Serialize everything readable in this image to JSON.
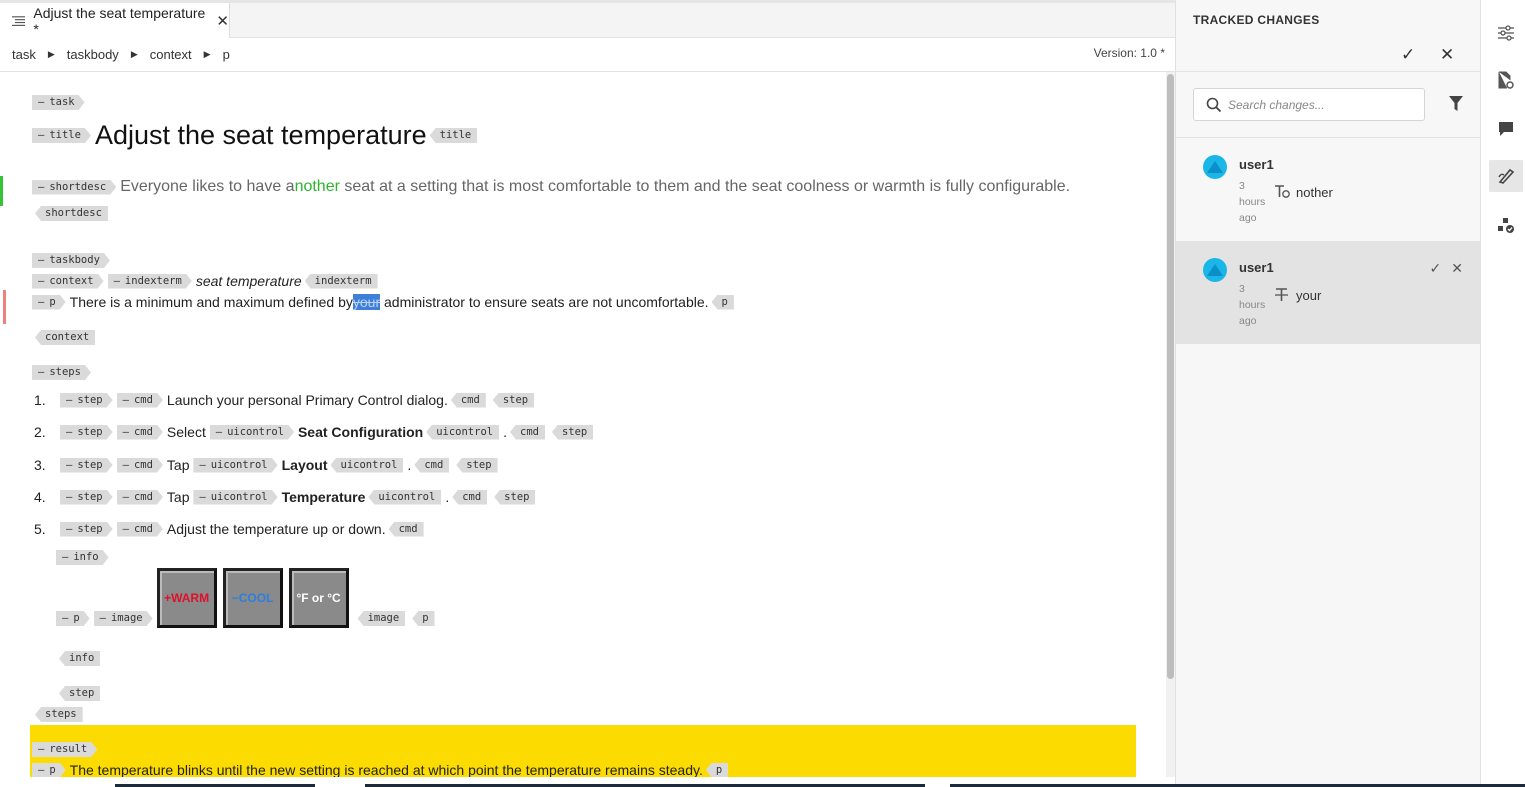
{
  "tab": {
    "title": "Adjust the seat temperature *",
    "close": "✕"
  },
  "breadcrumb": [
    "task",
    "taskbody",
    "context",
    "p"
  ],
  "version": "Version: 1.0 *",
  "doc": {
    "task_tag": "task",
    "title_tag": "title",
    "title": "Adjust the seat temperature",
    "shortdesc_tag": "shortdesc",
    "shortdesc_pre": "Everyone likes to have a",
    "shortdesc_ins": "nother",
    "shortdesc_post": " seat at a setting that is most comfortable to them and the seat coolness or warmth is fully configurable.",
    "taskbody_tag": "taskbody",
    "context_tag": "context",
    "indexterm_tag": "indexterm",
    "indexterm": "seat temperature",
    "p_tag": "p",
    "context_p_pre": "There is a minimum and maximum defined by",
    "context_p_del": "your",
    "context_p_post": " administrator to ensure seats are not uncomfortable.",
    "steps_tag": "steps",
    "step_tag": "step",
    "cmd_tag": "cmd",
    "uicontrol_tag": "uicontrol",
    "info_tag": "info",
    "image_tag": "image",
    "result_tag": "result",
    "steps": [
      {
        "num": "1.",
        "pre": "Launch your personal Primary Control dialog.",
        "ui": "",
        "post": ""
      },
      {
        "num": "2.",
        "pre": "Select ",
        "ui": "Seat Configuration",
        "post": "."
      },
      {
        "num": "3.",
        "pre": "Tap ",
        "ui": "Layout",
        "post": "."
      },
      {
        "num": "4.",
        "pre": "Tap ",
        "ui": "Temperature",
        "post": "."
      },
      {
        "num": "5.",
        "pre": "Adjust the temperature up or down.",
        "ui": "",
        "post": ""
      }
    ],
    "images": [
      {
        "label": "+WARM",
        "color": "#e0102a"
      },
      {
        "label": "−COOL",
        "color": "#2a7fe0"
      },
      {
        "label": "°F or °C",
        "color": "#ffffff"
      }
    ],
    "result_text": "The temperature blinks until the new setting is reached at which point the temperature remains steady."
  },
  "panel": {
    "title": "TRACKED CHANGES",
    "search_placeholder": "Search changes...",
    "changes": [
      {
        "user": "user1",
        "time": "3 hours ago",
        "type_icon": "insert-text-icon",
        "text": "nother"
      },
      {
        "user": "user1",
        "time": "3 hours ago",
        "type_icon": "delete-text-icon",
        "text": "your"
      }
    ]
  },
  "colors": {
    "highlight": "#fcdc00",
    "insert": "#2db52d",
    "delete_bg": "#3d7fd9"
  }
}
